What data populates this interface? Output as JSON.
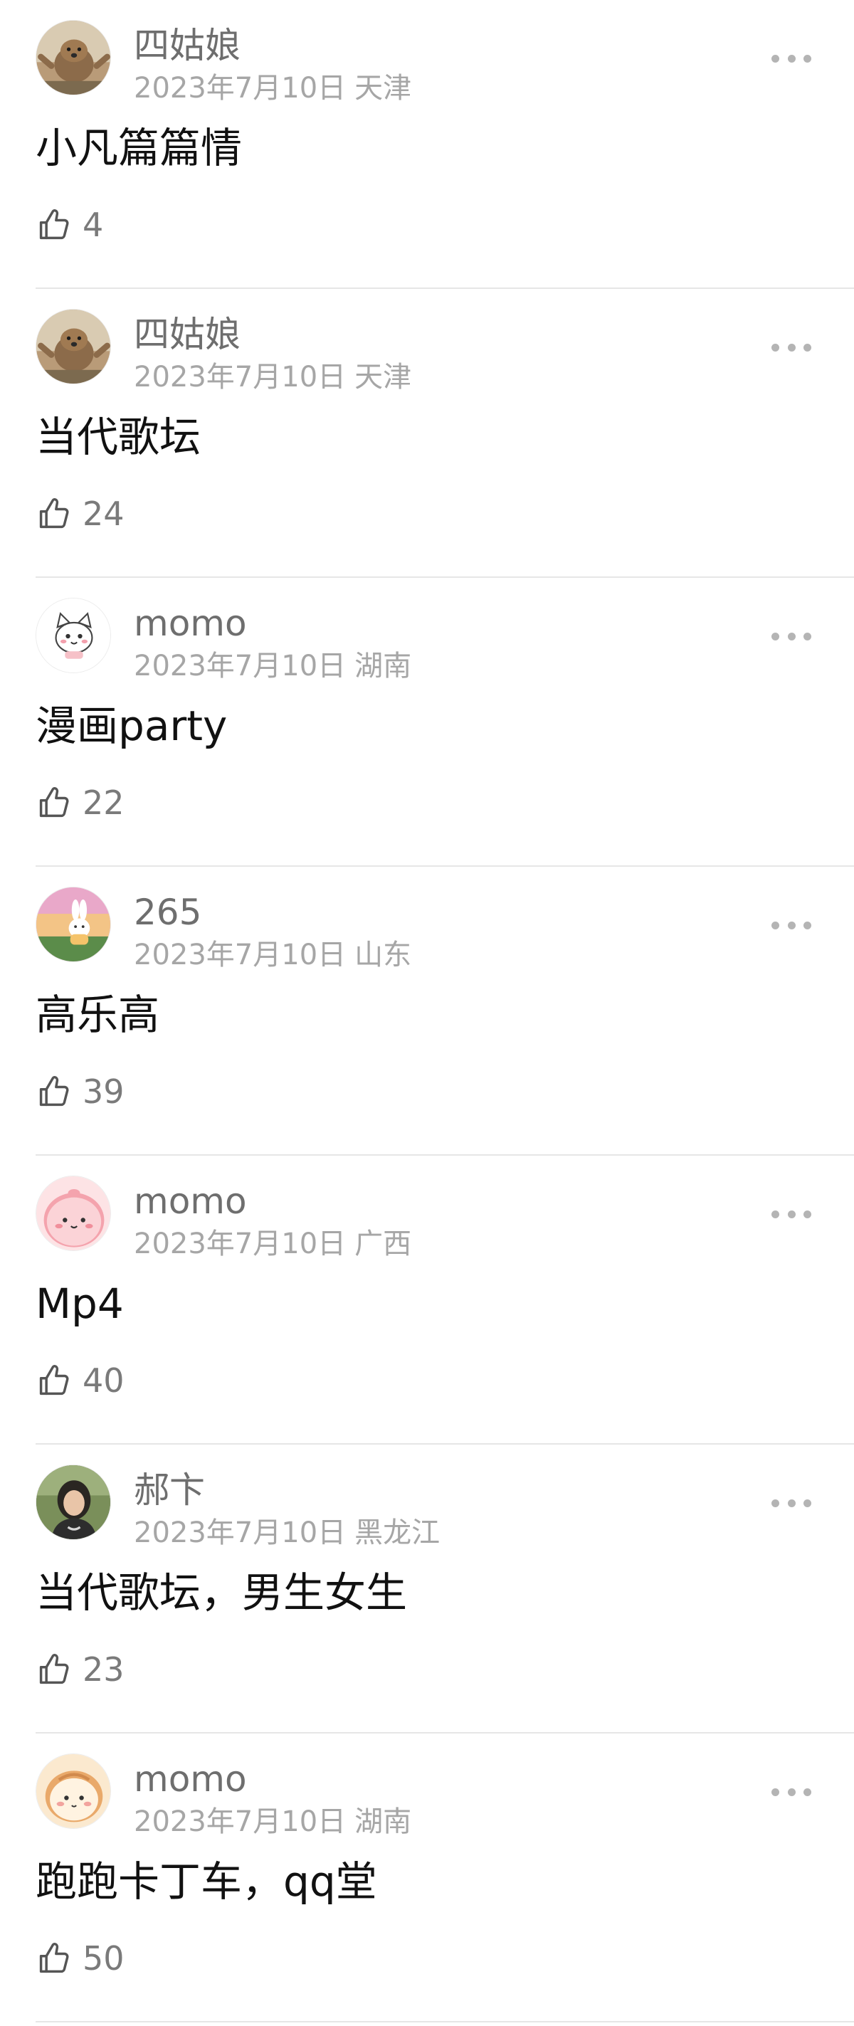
{
  "comments": [
    {
      "username": "四姑娘",
      "date": "2023年7月10日",
      "location": "天津",
      "text": "小凡篇篇情",
      "likes": "4",
      "avatar": {
        "icon": "quokka-photo-avatar",
        "bg": "#b99b78",
        "accent": "#8c6b4a"
      }
    },
    {
      "username": "四姑娘",
      "date": "2023年7月10日",
      "location": "天津",
      "text": "当代歌坛",
      "likes": "24",
      "avatar": {
        "icon": "quokka-photo-avatar",
        "bg": "#b99b78",
        "accent": "#8c6b4a"
      }
    },
    {
      "username": "momo",
      "date": "2023年7月10日",
      "location": "湖南",
      "text": "漫画party",
      "likes": "22",
      "avatar": {
        "icon": "cartoon-cat-avatar",
        "bg": "#ffffff",
        "accent": "#f3a0ad"
      }
    },
    {
      "username": "265",
      "date": "2023年7月10日",
      "location": "山东",
      "text": "高乐高",
      "likes": "39",
      "avatar": {
        "icon": "sunset-bunny-avatar",
        "bg": "#e9a8c9",
        "accent": "#f5c36a"
      }
    },
    {
      "username": "momo",
      "date": "2023年7月10日",
      "location": "广西",
      "text": "Mp4",
      "likes": "40",
      "avatar": {
        "icon": "pink-blob-avatar",
        "bg": "#fde3e5",
        "accent": "#f4a3ad"
      }
    },
    {
      "username": "郝卞",
      "date": "2023年7月10日",
      "location": "黑龙江",
      "text": "当代歌坛，男生女生",
      "likes": "23",
      "avatar": {
        "icon": "person-photo-avatar",
        "bg": "#4f6a3c",
        "accent": "#2a2622"
      }
    },
    {
      "username": "momo",
      "date": "2023年7月10日",
      "location": "湖南",
      "text": "跑跑卡丁车，qq堂",
      "likes": "50",
      "avatar": {
        "icon": "cartoon-bread-avatar",
        "bg": "#fbe9cf",
        "accent": "#e9a96a"
      }
    }
  ],
  "icons": {
    "like": "thumbs-up-icon",
    "more": "more-options-icon"
  },
  "colors": {
    "username": "#6e6e6e",
    "meta": "#a6a6a6",
    "text": "#111111",
    "divider": "#e6e6e6"
  }
}
